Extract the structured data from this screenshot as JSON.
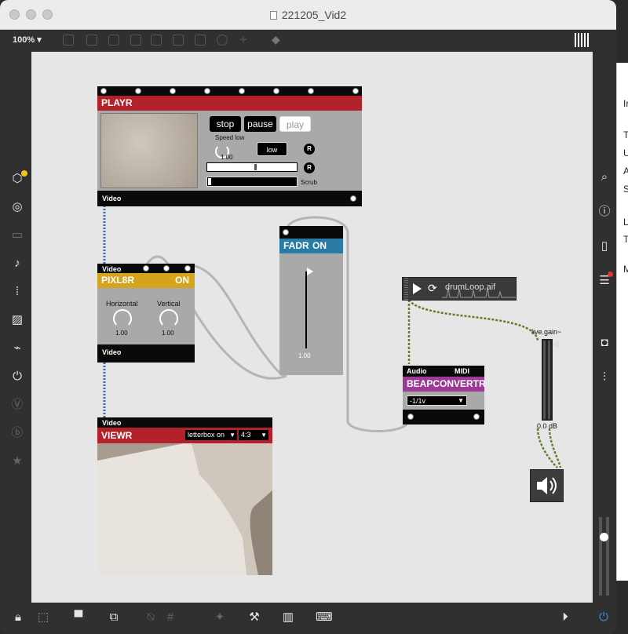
{
  "window": {
    "title": "221205_Vid2",
    "zoom_label": "100% ▾"
  },
  "colors": {
    "playr": "#b3222a",
    "pixl8r": "#d6a31d",
    "fadr": "#2a7aa6",
    "beap": "#9d3a96",
    "viewr": "#b3222a",
    "canvas": "#e6e6e6"
  },
  "playr": {
    "title": "PLAYR",
    "stop": "stop",
    "pause": "pause",
    "play": "play",
    "speed_label": "Speed low",
    "speed_value": "1.00",
    "low_button": "low",
    "r1": "R",
    "r2": "R",
    "scrub_label": "Scrub",
    "out_label": "Video"
  },
  "pixl8r": {
    "in_label": "Video",
    "title": "PIXL8R",
    "on": "ON",
    "horizontal_label": "Horizontal",
    "vertical_label": "Vertical",
    "horizontal_value": "1.00",
    "vertical_value": "1.00",
    "out_label": "Video"
  },
  "fadr": {
    "title": "FADR",
    "on": "ON",
    "value": "1.00",
    "level": 1.0
  },
  "player_obj": {
    "filename": "drumLoop.aif"
  },
  "live_gain": {
    "label": "live.gain~",
    "value": "0.0 dB"
  },
  "beap": {
    "audio_label": "Audio",
    "midi_label": "MIDI",
    "title": "BEAPCONVERTR",
    "menu": "-1/1v"
  },
  "viewr": {
    "in_label": "Video",
    "title": "VIEWR",
    "mode": "letterbox on",
    "aspect": "4:3"
  }
}
